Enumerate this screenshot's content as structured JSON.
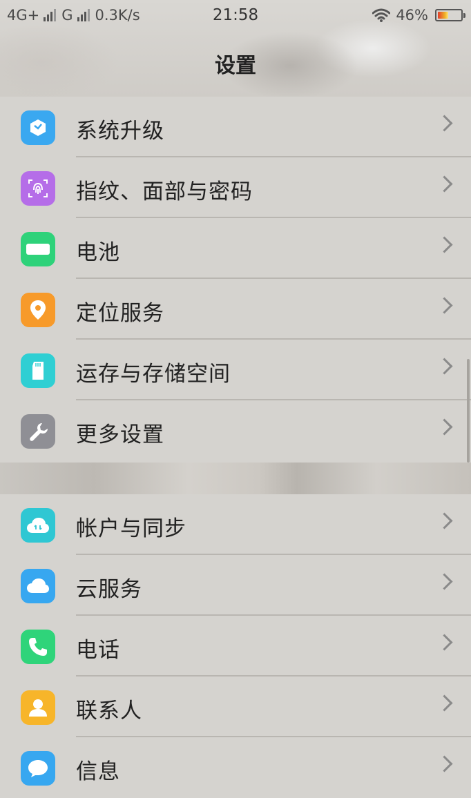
{
  "status_bar": {
    "network1": "4G+",
    "network2": "G",
    "speed": "0.3K/s",
    "time": "21:58",
    "battery_text": "46%",
    "battery_level": 0.46
  },
  "header": {
    "title": "设置"
  },
  "group1": {
    "items": [
      {
        "label": "系统升级",
        "icon": "system-update-icon",
        "color": "#3aa8f0"
      },
      {
        "label": "指纹、面部与密码",
        "icon": "fingerprint-icon",
        "color": "#b56de8"
      },
      {
        "label": "电池",
        "icon": "battery-icon",
        "color": "#2ed27a"
      },
      {
        "label": "定位服务",
        "icon": "location-icon",
        "color": "#f79a2a"
      },
      {
        "label": "运存与存储空间",
        "icon": "storage-icon",
        "color": "#2fcfd3"
      },
      {
        "label": "更多设置",
        "icon": "wrench-icon",
        "color": "#8f8f95"
      }
    ]
  },
  "group2": {
    "items": [
      {
        "label": "帐户与同步",
        "icon": "account-sync-icon",
        "color": "#2fc7d3"
      },
      {
        "label": "云服务",
        "icon": "cloud-icon",
        "color": "#37a7f0"
      },
      {
        "label": "电话",
        "icon": "phone-icon",
        "color": "#2fd47a"
      },
      {
        "label": "联系人",
        "icon": "contacts-icon",
        "color": "#f7b52a"
      },
      {
        "label": "信息",
        "icon": "message-icon",
        "color": "#37a7f0"
      }
    ]
  }
}
